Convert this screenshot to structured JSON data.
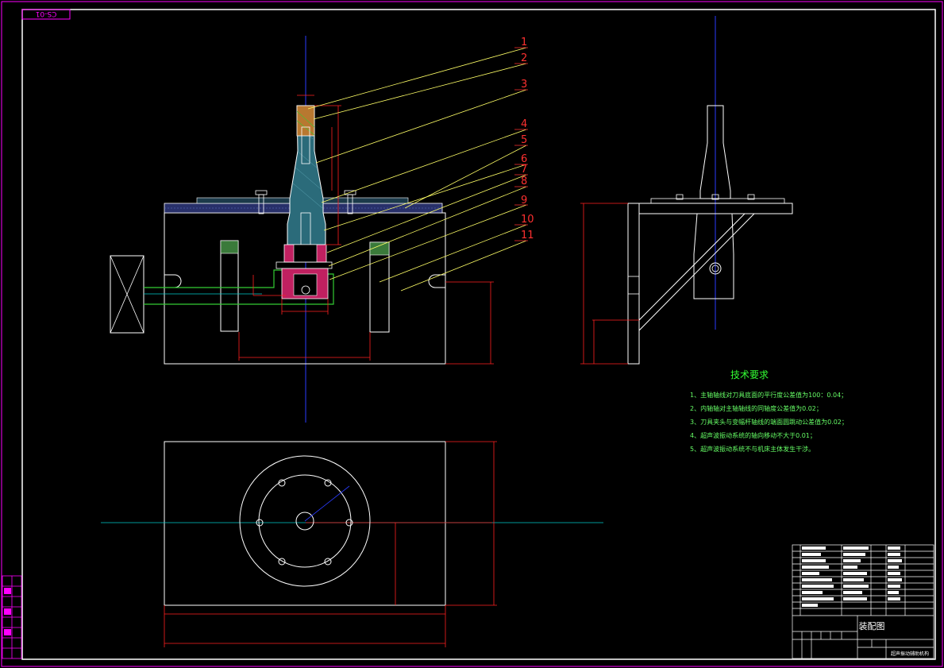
{
  "drawing_number": "CS-01",
  "balloons": [
    "1",
    "2",
    "3",
    "4",
    "5",
    "6",
    "7",
    "8",
    "9",
    "10",
    "11"
  ],
  "tech_requirements": {
    "title": "技术要求",
    "items": [
      "1、主轴轴线对刀具底面的平行度公差值为100：0.04；",
      "2、内轴轴对主轴轴线的同轴度公差值为0.02；",
      "3、刀具夹头与变幅杆轴线的端面圆跳动公差值为0.02；",
      "4、超声波振动系统的轴向移动不大于0.01；",
      "5、超声波振动系统不与机床主体发生干涉。"
    ]
  },
  "title_block": {
    "drawing_title": "装配图",
    "product_name": "超声振动辅助机构"
  },
  "colors": {
    "background": "#000000",
    "frame": "#ff00ff",
    "outline": "#ffffff",
    "centerline": "#2a3cff",
    "dimension": "#ff2020",
    "leader": "#ffff66",
    "section_cyan": "#00cccc",
    "section_green": "#33cc33",
    "balloon_text": "#ff3030",
    "tech_title": "#33ff33",
    "tech_text": "#66ff66"
  }
}
